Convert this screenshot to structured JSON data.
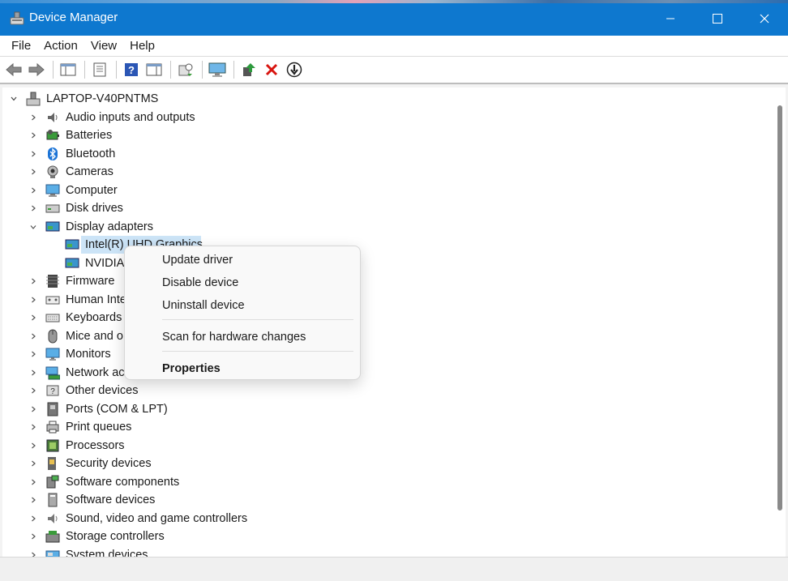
{
  "window": {
    "title": "Device Manager",
    "minimize_icon": "minimize-icon",
    "maximize_icon": "maximize-icon",
    "close_icon": "close-icon",
    "accent": "#0e78cf"
  },
  "menubar": {
    "items": [
      "File",
      "Action",
      "View",
      "Help"
    ]
  },
  "toolbar": {
    "icons": [
      "back-arrow-icon",
      "forward-arrow-icon",
      "show-hide-console-tree-icon",
      "properties-icon",
      "help-icon",
      "action-pane-icon",
      "scan-hardware-icon",
      "monitor-icon",
      "update-driver-icon",
      "uninstall-device-icon",
      "disable-device-icon"
    ]
  },
  "tree": {
    "root": "LAPTOP-V40PNTMS",
    "categories": [
      {
        "label": "Audio inputs and outputs",
        "icon": "speaker-icon"
      },
      {
        "label": "Batteries",
        "icon": "battery-icon"
      },
      {
        "label": "Bluetooth",
        "icon": "bluetooth-icon"
      },
      {
        "label": "Cameras",
        "icon": "camera-icon"
      },
      {
        "label": "Computer",
        "icon": "computer-icon"
      },
      {
        "label": "Disk drives",
        "icon": "disk-drive-icon"
      },
      {
        "label": "Display adapters",
        "icon": "display-adapter-icon"
      },
      {
        "label": "Firmware",
        "icon": "firmware-icon"
      },
      {
        "label": "Human Inte",
        "icon": "hid-icon"
      },
      {
        "label": "Keyboards",
        "icon": "keyboard-icon"
      },
      {
        "label": "Mice and o",
        "icon": "mouse-icon"
      },
      {
        "label": "Monitors",
        "icon": "monitor-icon"
      },
      {
        "label": "Network ac",
        "icon": "network-icon"
      },
      {
        "label": "Other devices",
        "icon": "other-devices-icon"
      },
      {
        "label": "Ports (COM & LPT)",
        "icon": "port-icon"
      },
      {
        "label": "Print queues",
        "icon": "printer-icon"
      },
      {
        "label": "Processors",
        "icon": "processor-icon"
      },
      {
        "label": "Security devices",
        "icon": "security-device-icon"
      },
      {
        "label": "Software components",
        "icon": "software-component-icon"
      },
      {
        "label": "Software devices",
        "icon": "software-device-icon"
      },
      {
        "label": "Sound, video and game controllers",
        "icon": "sound-icon"
      },
      {
        "label": "Storage controllers",
        "icon": "storage-icon"
      },
      {
        "label": "System devices",
        "icon": "system-devices-icon"
      }
    ],
    "display_children": [
      {
        "label": "Intel(R) UHD Graphics",
        "selected": true
      },
      {
        "label": "NVIDIA",
        "selected": false
      }
    ],
    "selection_color": "#cce4f7"
  },
  "context_menu": {
    "items": [
      {
        "label": "Update driver"
      },
      {
        "label": "Disable device"
      },
      {
        "label": "Uninstall device"
      },
      {
        "label": "Scan for hardware changes"
      },
      {
        "label": "Properties",
        "bold": true
      }
    ]
  }
}
